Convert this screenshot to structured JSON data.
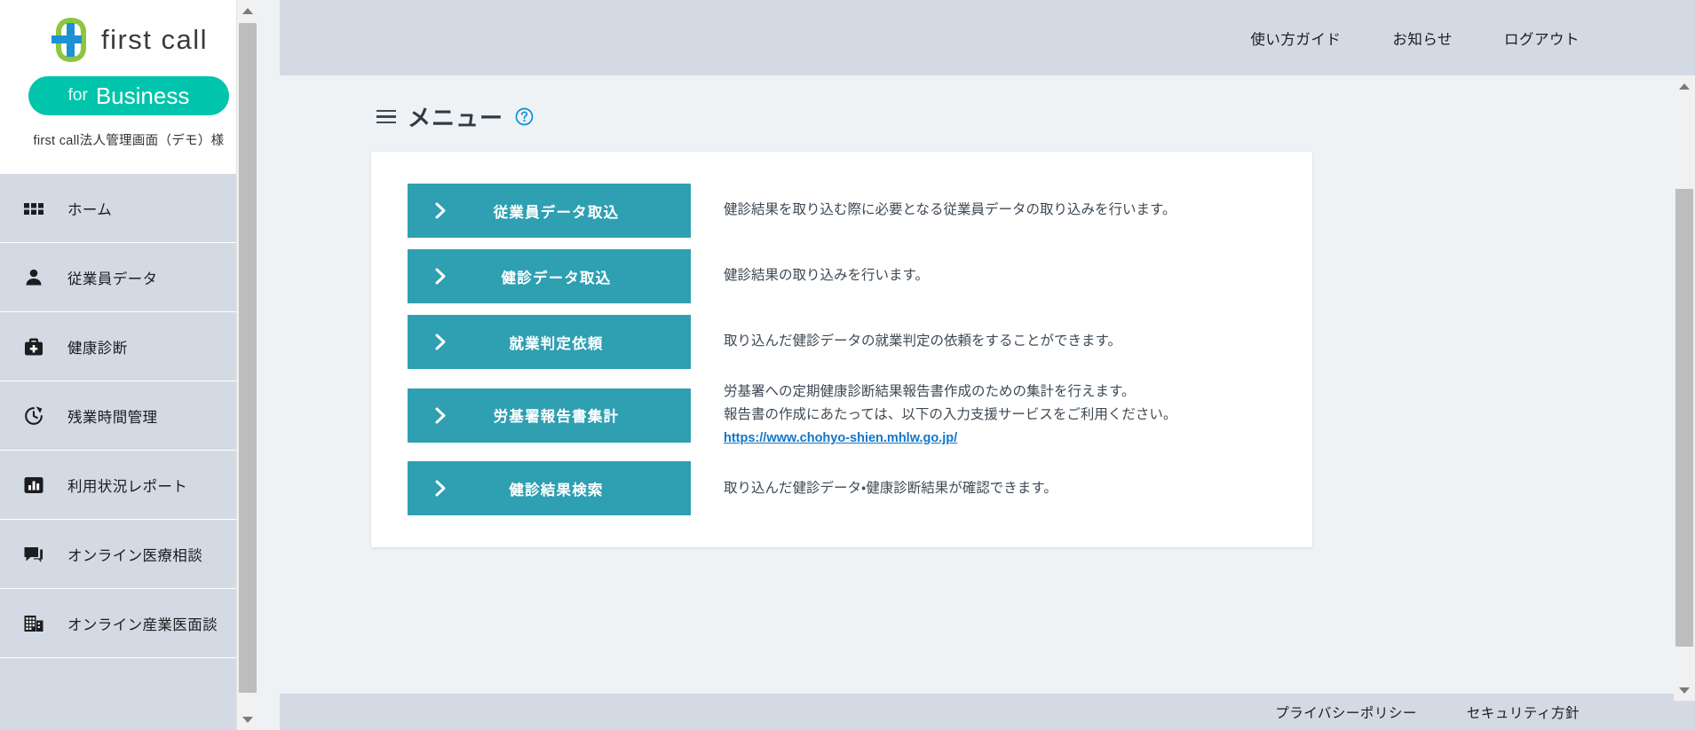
{
  "brand": {
    "name": "first call",
    "badge_for": "for",
    "badge_business": "Business",
    "org_name": "first call法人管理画面（デモ）様",
    "teal_accent": "#2f9fb2",
    "badge_color": "#00c4ab",
    "sidebar_color": "#d3dae3",
    "link_color": "#1276c9"
  },
  "topbar": {
    "links": [
      {
        "label": "使い方ガイド"
      },
      {
        "label": "お知らせ"
      },
      {
        "label": "ログアウト"
      }
    ]
  },
  "sidebar": {
    "items": [
      {
        "label": "ホーム",
        "icon": "grid-icon"
      },
      {
        "label": "従業員データ",
        "icon": "person-icon"
      },
      {
        "label": "健康診断",
        "icon": "medical-bag-icon"
      },
      {
        "label": "残業時間管理",
        "icon": "clock-refresh-icon"
      },
      {
        "label": "利用状況レポート",
        "icon": "bar-chart-icon"
      },
      {
        "label": "オンライン医療相談",
        "icon": "chat-bubble-icon"
      },
      {
        "label": "オンライン産業医面談",
        "icon": "building-icon"
      }
    ]
  },
  "page": {
    "title": "メニュー",
    "menu_icon": "hamburger-icon",
    "help_icon": "question-circle-icon"
  },
  "menu": {
    "items": [
      {
        "label": "従業員データ取込",
        "chevron": "chevron-right-icon",
        "description_lines": [
          "健診結果を取り込む際に必要となる従業員データの取り込みを行います。"
        ],
        "link": null
      },
      {
        "label": "健診データ取込",
        "chevron": "chevron-right-icon",
        "description_lines": [
          "健診結果の取り込みを行います。"
        ],
        "link": null
      },
      {
        "label": "就業判定依頼",
        "chevron": "chevron-right-icon",
        "description_lines": [
          "取り込んだ健診データの就業判定の依頼をすることができます。"
        ],
        "link": null
      },
      {
        "label": "労基署報告書集計",
        "chevron": "chevron-right-icon",
        "description_lines": [
          "労基署への定期健康診断結果報告書作成のための集計を行えます。",
          "報告書の作成にあたっては、以下の入力支援サービスをご利用ください。"
        ],
        "link": "https://www.chohyo-shien.mhlw.go.jp/"
      },
      {
        "label": "健診結果検索",
        "chevron": "chevron-right-icon",
        "description_lines": [
          "取り込んだ健診データ・健康診断結果が確認できます。"
        ],
        "link": null
      }
    ]
  },
  "footer": {
    "links": [
      {
        "label": "プライバシーポリシー"
      },
      {
        "label": "セキュリティ方針"
      }
    ]
  }
}
